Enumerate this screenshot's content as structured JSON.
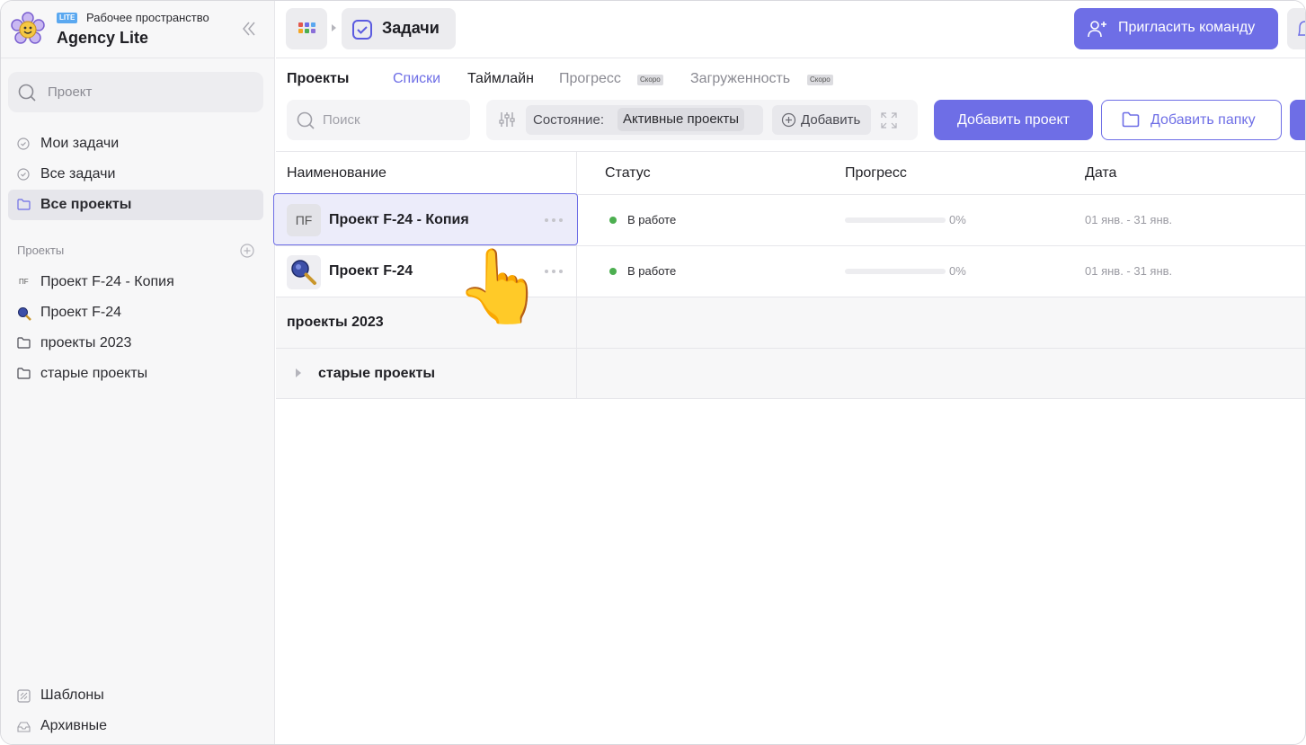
{
  "workspace": {
    "badge": "LITE",
    "subtitle": "Рабочее пространство",
    "name": "Agency Lite"
  },
  "sidebar": {
    "search_placeholder": "Проект",
    "nav": [
      {
        "label": "Мои задачи",
        "icon": "check-circle-icon"
      },
      {
        "label": "Все задачи",
        "icon": "check-circle-icon"
      },
      {
        "label": "Все проекты",
        "icon": "folder-icon",
        "active": true
      }
    ],
    "projects_title": "Проекты",
    "projects": [
      {
        "label": "Проект F-24 - Копия",
        "icon": "pf-initials-icon",
        "initials": "ПF"
      },
      {
        "label": "Проект F-24",
        "icon": "magnifier-avatar-icon"
      },
      {
        "label": "проекты 2023",
        "icon": "folder-icon"
      },
      {
        "label": "старые проекты",
        "icon": "folder-icon"
      }
    ],
    "footer": [
      {
        "label": "Шаблоны",
        "icon": "templates-icon"
      },
      {
        "label": "Архивные",
        "icon": "archive-icon"
      }
    ]
  },
  "topbar": {
    "breadcrumb_label": "Задачи",
    "invite_label": "Пригласить команду"
  },
  "tabs": {
    "projects": "Проекты",
    "lists": "Списки",
    "timeline": "Таймлайн",
    "progress": "Прогресс",
    "workload": "Загруженность",
    "soon": "Скоро"
  },
  "toolbar": {
    "search_placeholder": "Поиск",
    "state_label": "Состояние:",
    "state_value": "Активные проекты",
    "add_filter": "Добавить",
    "add_project": "Добавить проект",
    "add_folder": "Добавить папку"
  },
  "table": {
    "headers": {
      "name": "Наименование",
      "status": "Статус",
      "progress": "Прогресс",
      "date": "Дата"
    },
    "rows": [
      {
        "initials": "ПF",
        "name": "Проект F-24 - Копия",
        "status": "В работе",
        "progress": 0,
        "progress_text": "0%",
        "date": "01 янв. - 31 янв."
      },
      {
        "name": "Проект F-24",
        "status": "В работе",
        "progress": 0,
        "progress_text": "0%",
        "date": "01 янв. - 31 янв."
      }
    ],
    "groups": [
      {
        "name": "проекты 2023"
      },
      {
        "name": "старые проекты"
      }
    ]
  },
  "colors": {
    "accent": "#6e6ee6",
    "status_green": "#4caf50"
  },
  "pointer_emoji": "👆"
}
